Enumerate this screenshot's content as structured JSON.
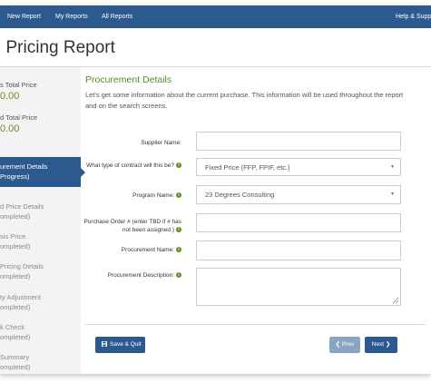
{
  "nav": {
    "new_report": "New Report",
    "my_reports": "My Reports",
    "all_reports": "All Reports",
    "help": "Help & Suppo"
  },
  "page_title": "l Pricing Report",
  "sidebar": {
    "totals": [
      {
        "label": "s Total Price",
        "value": "0.00"
      },
      {
        "label": "d Total Price",
        "value": "0.00"
      }
    ],
    "active_step": {
      "line1": "urement Details",
      "line2": "Progress)"
    },
    "steps": [
      {
        "line1": "d Price Details",
        "line2": "ompleted)"
      },
      {
        "line1": "sis Price",
        "line2": "ompleted)"
      },
      {
        "line1": "Pricing Details",
        "line2": "ompleted)"
      },
      {
        "line1": "ty Adjustment",
        "line2": "ompleted)"
      },
      {
        "line1": "k Check",
        "line2": "ompleted)"
      },
      {
        "line1": "Summary",
        "line2": "ompleted)"
      }
    ]
  },
  "form": {
    "title": "Procurement Details",
    "intro": "Let's get some information about the current purchase. This information will be used throughout the report and on the search screens.",
    "supplier_label": "Supplier Name:",
    "supplier_value": "",
    "contract_label": "What type of contract will this be?",
    "contract_value": "Fixed Price (FFP, FPIF, etc.)",
    "program_label": "Program Name:",
    "program_value": "23 Degrees Consulting",
    "po_label_1": "Purchase Order # (enter TBD if # has",
    "po_label_2": "not been assigned.)",
    "po_value": "",
    "procurement_name_label": "Procurement Name:",
    "procurement_name_value": "",
    "description_label": "Procurement Description:",
    "description_value": "",
    "info_glyph": "i"
  },
  "buttons": {
    "save_quit": "Save & Quit",
    "prev": "Prev",
    "next": "Next"
  },
  "colors": {
    "nav_blue": "#2c5a8f",
    "accent_green": "#5b8c2a",
    "prev_disabled": "#8aa5c2"
  }
}
